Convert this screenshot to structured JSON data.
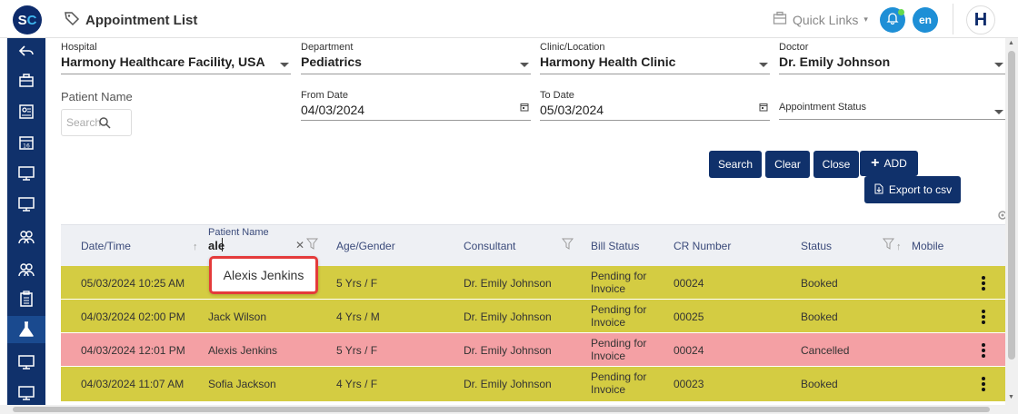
{
  "header": {
    "logo_s": "S",
    "logo_c": "C",
    "title": "Appointment List",
    "quick_links": "Quick Links",
    "lang": "en",
    "user_initial": "H"
  },
  "filters": {
    "hospital": {
      "label": "Hospital",
      "value": "Harmony Healthcare Facility, USA"
    },
    "department": {
      "label": "Department",
      "value": "Pediatrics"
    },
    "clinic": {
      "label": "Clinic/Location",
      "value": "Harmony Health Clinic"
    },
    "doctor": {
      "label": "Doctor",
      "value": "Dr. Emily Johnson"
    },
    "patient_name": {
      "label": "Patient Name",
      "placeholder": "Search"
    },
    "from_date": {
      "label": "From Date",
      "value": "04/03/2024"
    },
    "to_date": {
      "label": "To Date",
      "value": "05/03/2024"
    },
    "appointment_status": {
      "label": "Appointment Status"
    }
  },
  "buttons": {
    "search": "Search",
    "clear": "Clear",
    "close": "Close",
    "add": "ADD",
    "export": "Export to csv"
  },
  "table": {
    "columns": {
      "datetime": "Date/Time",
      "patient_name": "Patient Name",
      "age_gender": "Age/Gender",
      "consultant": "Consultant",
      "bill_status": "Bill Status",
      "cr_number": "CR Number",
      "status": "Status",
      "mobile": "Mobile"
    },
    "patient_filter_value": "ale",
    "rows": [
      {
        "datetime": "05/03/2024 10:25 AM",
        "patient": "",
        "age": "5 Yrs / F",
        "consultant": "Dr. Emily Johnson",
        "bill_1": "Pending for",
        "bill_2": "Invoice",
        "cr": "00024",
        "status": "Booked"
      },
      {
        "datetime": "04/03/2024 02:00 PM",
        "patient": "Jack Wilson",
        "age": "4 Yrs / M",
        "consultant": "Dr. Emily Johnson",
        "bill_1": "Pending for",
        "bill_2": "Invoice",
        "cr": "00025",
        "status": "Booked"
      },
      {
        "datetime": "04/03/2024 12:01 PM",
        "patient": "Alexis Jenkins",
        "age": "5 Yrs / F",
        "consultant": "Dr. Emily Johnson",
        "bill_1": "Pending for",
        "bill_2": "Invoice",
        "cr": "00024",
        "status": "Cancelled"
      },
      {
        "datetime": "04/03/2024 11:07 AM",
        "patient": "Sofia Jackson",
        "age": "4 Yrs / F",
        "consultant": "Dr. Emily Johnson",
        "bill_1": "Pending for",
        "bill_2": "Invoice",
        "cr": "00023",
        "status": "Booked"
      }
    ]
  },
  "autocomplete": {
    "suggestion": "Alexis Jenkins"
  },
  "colors": {
    "brand": "#10316b",
    "booked": "#d4cc42",
    "cancelled": "#f4a0a4",
    "highlight": "#e43b3b"
  }
}
